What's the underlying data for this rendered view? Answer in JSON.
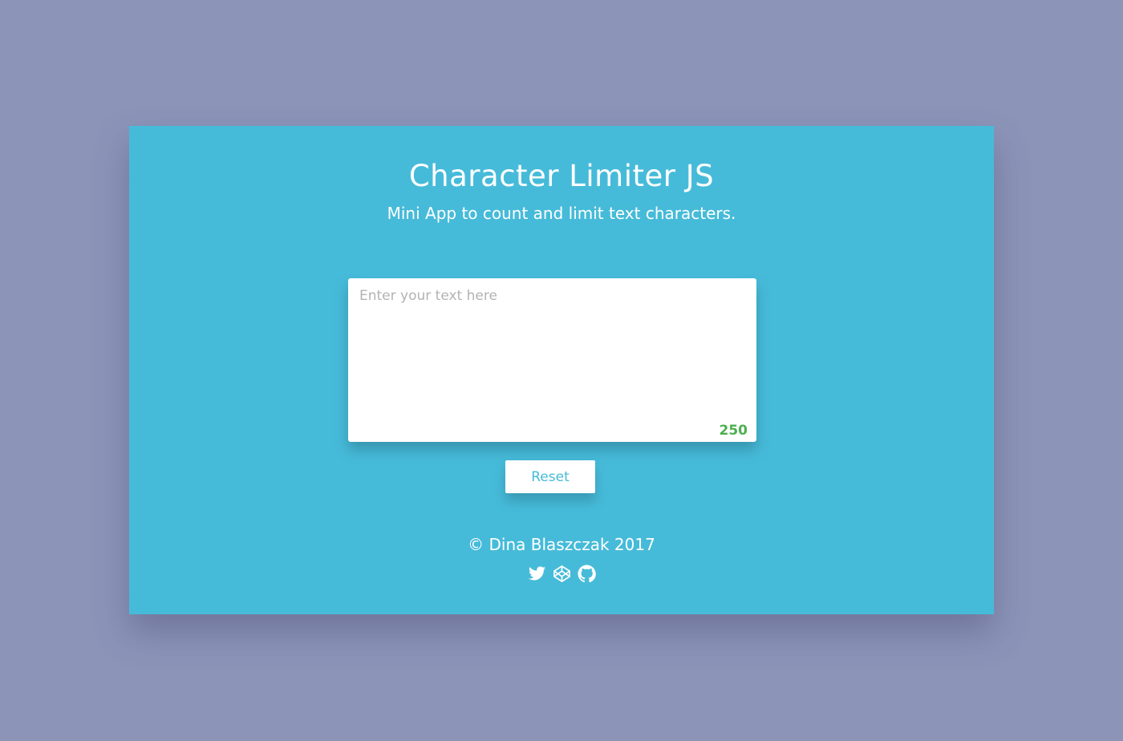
{
  "app": {
    "title": "Character Limiter JS",
    "subtitle": "Mini App to count and limit text characters."
  },
  "editor": {
    "placeholder": "Enter your text here",
    "value": "",
    "remaining_count": "250"
  },
  "actions": {
    "reset_label": "Reset"
  },
  "footer": {
    "credit": "© Dina Blaszczak 2017",
    "social_icons": [
      "twitter-icon",
      "codepen-icon",
      "github-icon"
    ]
  },
  "colors": {
    "page_background": "#8c94b8",
    "card_background": "#46bbd9",
    "counter": "#4caf50",
    "button_text": "#46bbd9"
  }
}
